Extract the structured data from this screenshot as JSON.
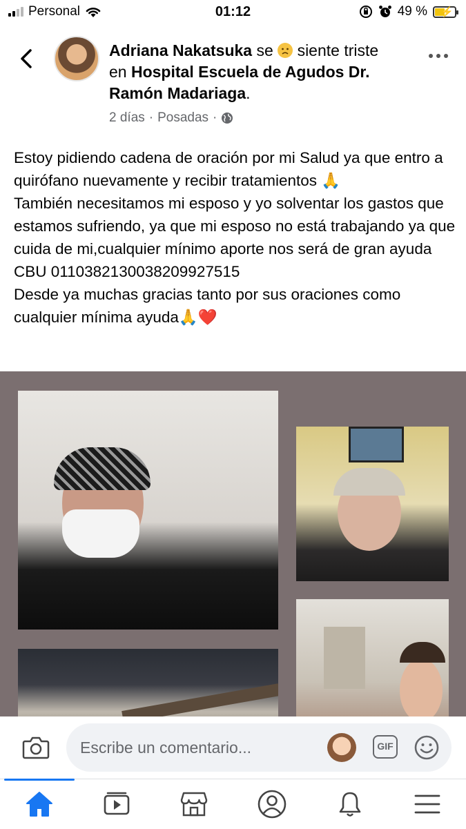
{
  "status_bar": {
    "carrier": "Personal",
    "time": "01:12",
    "battery_percent": "49 %",
    "battery_level": 0.49
  },
  "post": {
    "author": "Adriana Nakatsuka",
    "feeling_prefix": "se",
    "feeling": "siente triste",
    "location_prefix": "en",
    "location": "Hospital Escuela de Agudos Dr. Ramón Madariaga",
    "location_suffix": ".",
    "time_ago": "2 días",
    "separator": "·",
    "posted_in": "Posadas",
    "privacy_icon": "globe-icon",
    "text": "Estoy pidiendo cadena de oración por mi Salud ya que entro  a quirófano nuevamente y recibir tratamientos 🙏\nTambién necesitamos mi esposo y yo solventar los gastos que estamos sufriendo, ya que  mi esposo no está trabajando ya que cuida de mi,cualquier mínimo aporte nos será de gran ayuda\nCBU 0110382130038209927515\nDesde ya muchas gracias tanto por sus oraciones como cualquier mínima ayuda🙏❤️"
  },
  "comment_bar": {
    "placeholder": "Escribe un comentario...",
    "gif_label": "GIF"
  },
  "tab_bar": {
    "items": [
      "home-icon",
      "watch-icon",
      "marketplace-icon",
      "profile-icon",
      "notifications-icon",
      "menu-icon"
    ],
    "active": "home-icon",
    "accent": "#1877f2"
  },
  "colors": {
    "collage_background": "#7b6f70",
    "secondary_text": "#65676b"
  }
}
